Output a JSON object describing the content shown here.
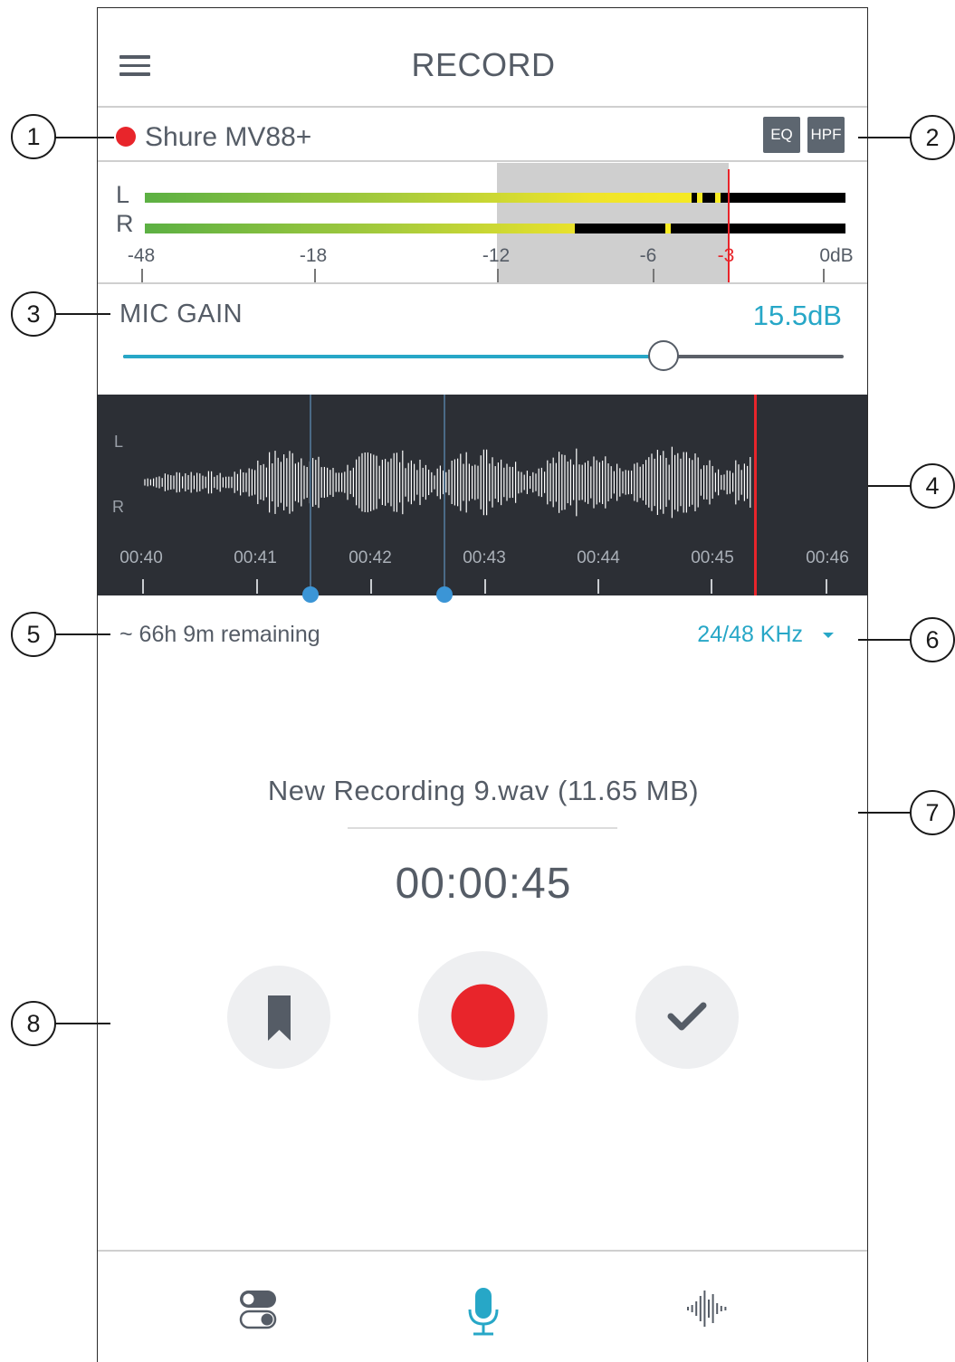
{
  "header": {
    "title": "RECORD"
  },
  "device": {
    "name": "Shure MV88+",
    "badges": [
      "EQ",
      "HPF"
    ]
  },
  "meter": {
    "channels": [
      "L",
      "R"
    ],
    "scale": [
      "-48",
      "-18",
      "-12",
      "-6",
      "-3",
      "0dB"
    ],
    "levels_db": {
      "L": -4.0,
      "R": -9.0
    },
    "peak_db": {
      "L": -3.5,
      "R": -5.5
    }
  },
  "gain": {
    "label": "MIC GAIN",
    "value": "15.5dB",
    "position": 0.75
  },
  "waveform": {
    "channels": [
      "L",
      "R"
    ],
    "times": [
      "00:40",
      "00:41",
      "00:42",
      "00:43",
      "00:44",
      "00:45",
      "00:46"
    ]
  },
  "info": {
    "remaining": "~ 66h 9m remaining",
    "format": "24/48 KHz"
  },
  "recording": {
    "filename": "New Recording 9.wav (11.65 MB)",
    "elapsed": "00:00:45"
  },
  "callouts": [
    "1",
    "2",
    "3",
    "4",
    "5",
    "6",
    "7",
    "8"
  ],
  "colors": {
    "accent": "#27a7c7",
    "record": "#e8252b",
    "panel": "#2c2f35"
  },
  "icons": [
    "menu-icon",
    "bookmark-icon",
    "record-icon",
    "check-icon",
    "settings-toggle-icon",
    "microphone-icon",
    "waveform-icon"
  ]
}
